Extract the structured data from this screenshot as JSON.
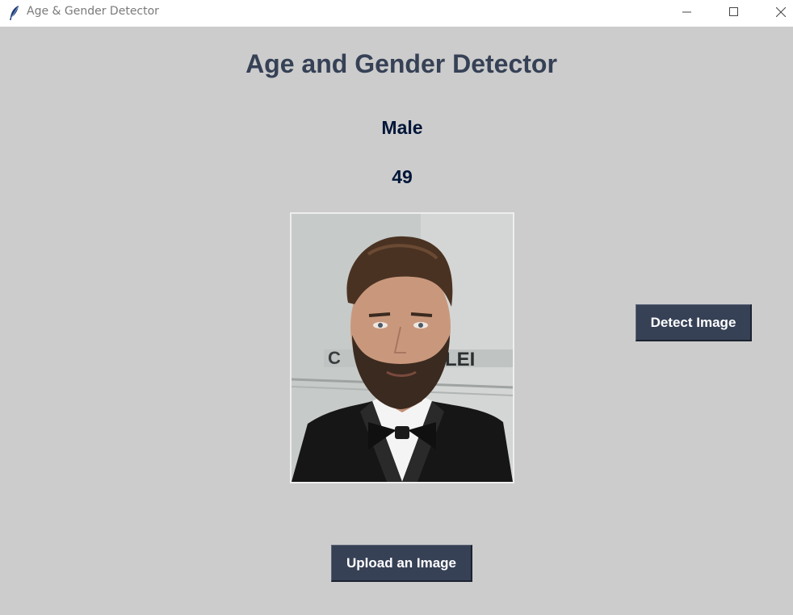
{
  "window": {
    "title": "Age & Gender Detector",
    "icon": "feather-icon",
    "controls": [
      "minimize-icon",
      "maximize-icon",
      "close-icon"
    ]
  },
  "main": {
    "heading": "Age and Gender Detector",
    "gender": "Male",
    "age": "49",
    "image": {
      "description_icon": "uploaded-portrait-image"
    },
    "detect_button_label": "Detect Image",
    "upload_button_label": "Upload an Image"
  },
  "colors": {
    "background": "#cccccc",
    "heading": "#364156",
    "result_text": "#011638",
    "button_bg": "#364156",
    "button_text": "#ffffff"
  }
}
